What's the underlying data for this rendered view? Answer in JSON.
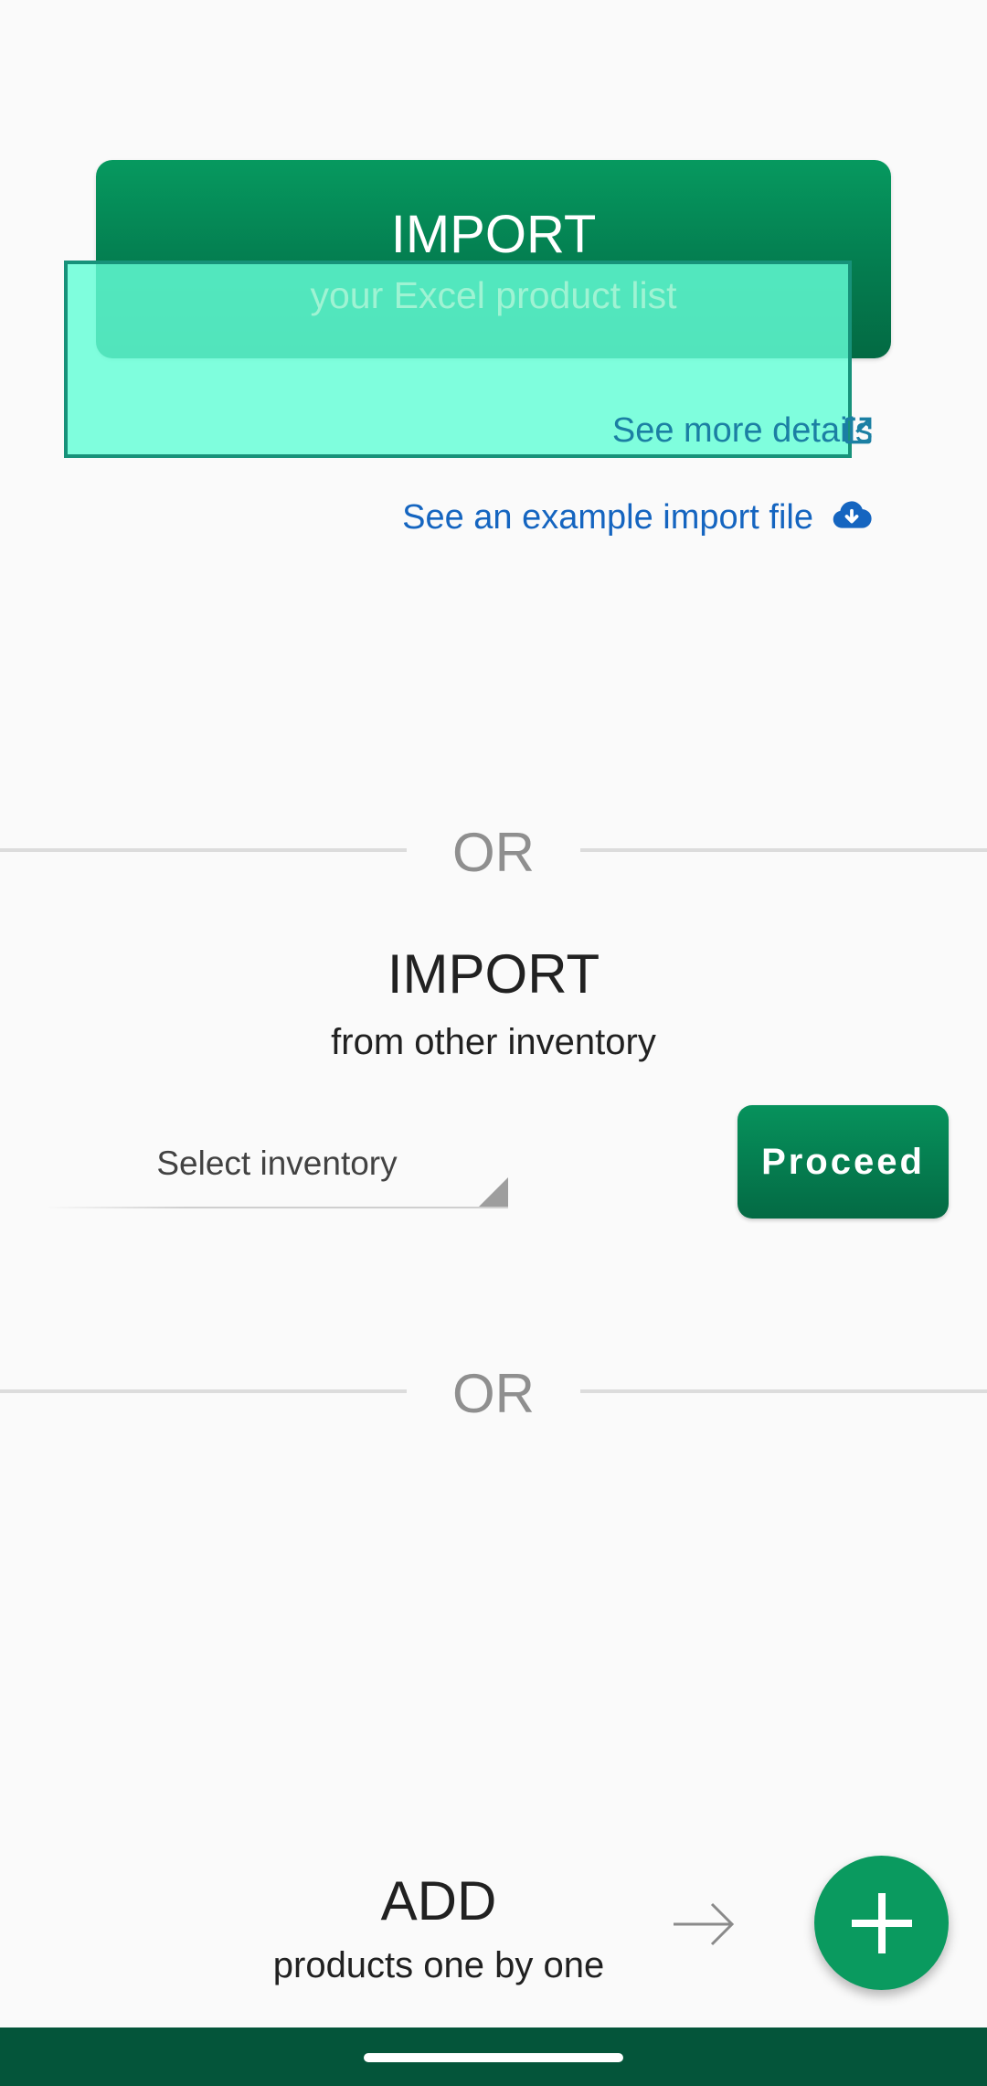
{
  "excel_import": {
    "title": "IMPORT",
    "subtitle": "your Excel product list",
    "details_link": "See more details",
    "example_link": "See an example import file"
  },
  "divider_text": "OR",
  "inventory_import": {
    "title": "IMPORT",
    "subtitle": "from other inventory",
    "select_value": "Select inventory",
    "proceed_label": "Proceed"
  },
  "add_products": {
    "title": "ADD",
    "subtitle": "products one by one"
  },
  "icons": {
    "details": "external-link-icon",
    "example": "cloud-download-icon",
    "arrow": "arrow-right-icon",
    "fab": "plus-icon"
  },
  "colors": {
    "primary_green": "#06995f",
    "dark_green": "#04553a",
    "link_blue": "#1565c0",
    "overlay_teal": "#64ffd7"
  }
}
